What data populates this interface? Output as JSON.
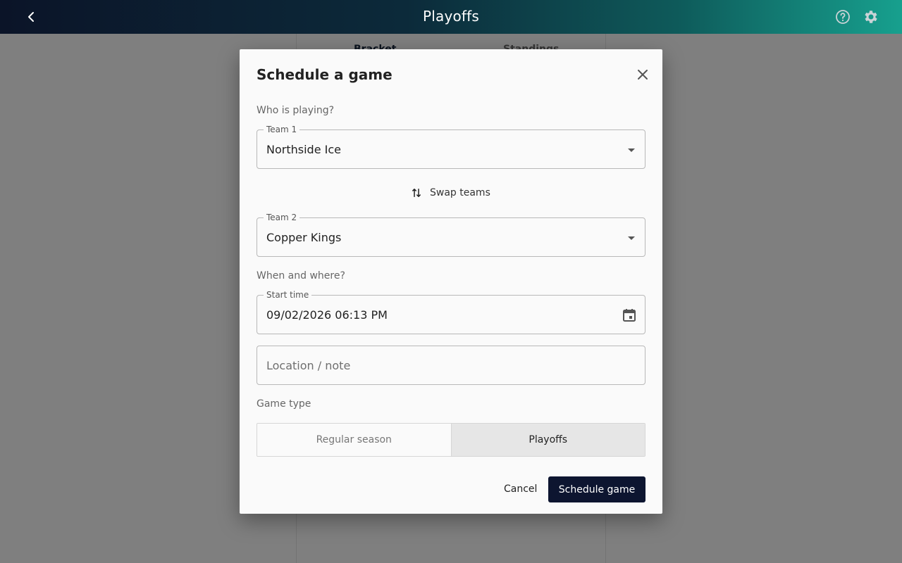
{
  "app": {
    "title": "Playoffs",
    "icons": {
      "back": "chevron-left-icon",
      "help": "help-circle-icon",
      "settings": "gear-icon"
    }
  },
  "background": {
    "tabs": [
      "Bracket",
      "Standings"
    ]
  },
  "dialog": {
    "title": "Schedule a game",
    "section_teams": "Who is playing?",
    "team1": {
      "label": "Team 1",
      "value": "Northside Ice"
    },
    "swap_label": "Swap teams",
    "team2": {
      "label": "Team 2",
      "value": "Copper Kings"
    },
    "section_when": "When and where?",
    "start_time": {
      "label": "Start time",
      "value": "09/02/2026 06:13 PM"
    },
    "location": {
      "placeholder": "Location / note",
      "value": ""
    },
    "section_type": "Game type",
    "game_types": [
      "Regular season",
      "Playoffs"
    ],
    "selected_game_type": "Playoffs",
    "cancel_label": "Cancel",
    "submit_label": "Schedule game"
  },
  "colors": {
    "primary": "#0d1530",
    "header_gradient_start": "#0b1428",
    "header_gradient_end": "#17a08e",
    "selected_segment": "#e6e6e6"
  }
}
